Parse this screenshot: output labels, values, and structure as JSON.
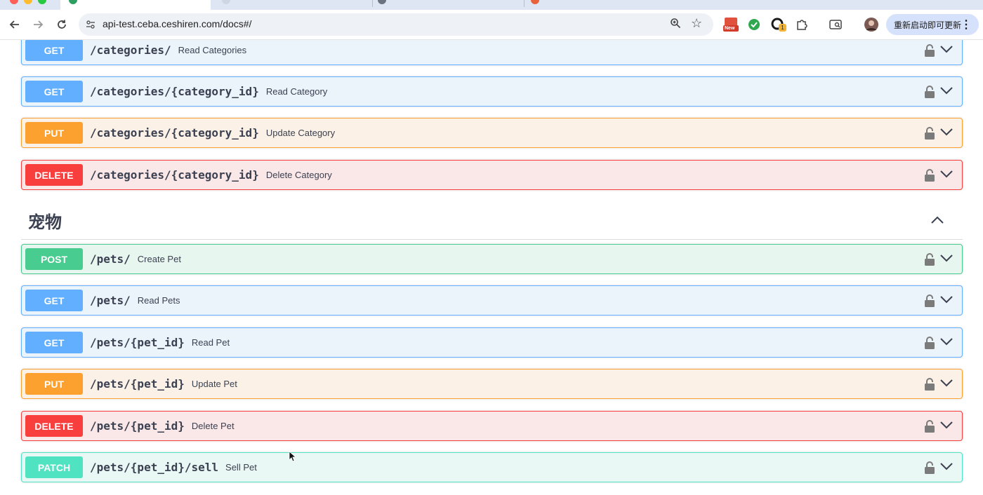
{
  "browser": {
    "url": "api-test.ceba.ceshiren.com/docs#/",
    "update_button_label": "重新启动即可更新",
    "extension_badge_new": "New",
    "extension_badge_count": "1"
  },
  "colors": {
    "get": "#61affe",
    "put": "#fca130",
    "delete": "#f93e3e",
    "post": "#49cc90",
    "patch": "#50e3c2"
  },
  "sections": [
    {
      "title": "",
      "operations": [
        {
          "method": "GET",
          "path": "/categories/",
          "summary": "Read Categories"
        },
        {
          "method": "GET",
          "path": "/categories/{category_id}",
          "summary": "Read Category"
        },
        {
          "method": "PUT",
          "path": "/categories/{category_id}",
          "summary": "Update Category"
        },
        {
          "method": "DELETE",
          "path": "/categories/{category_id}",
          "summary": "Delete Category"
        }
      ]
    },
    {
      "title": "宠物",
      "operations": [
        {
          "method": "POST",
          "path": "/pets/",
          "summary": "Create Pet"
        },
        {
          "method": "GET",
          "path": "/pets/",
          "summary": "Read Pets"
        },
        {
          "method": "GET",
          "path": "/pets/{pet_id}",
          "summary": "Read Pet"
        },
        {
          "method": "PUT",
          "path": "/pets/{pet_id}",
          "summary": "Update Pet"
        },
        {
          "method": "DELETE",
          "path": "/pets/{pet_id}",
          "summary": "Delete Pet"
        },
        {
          "method": "PATCH",
          "path": "/pets/{pet_id}/sell",
          "summary": "Sell Pet"
        }
      ]
    }
  ]
}
